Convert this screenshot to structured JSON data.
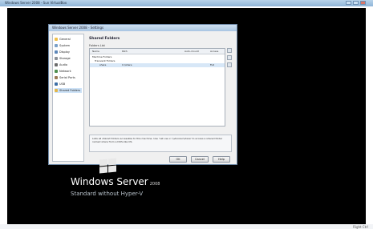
{
  "window": {
    "title": "Windows Server 2008 - Sun VirtualBox"
  },
  "status_bar": {
    "text": "Right Ctrl"
  },
  "background": {
    "product": "Windows Server",
    "version": "2008",
    "subtitle": "Standard without Hyper-V"
  },
  "dialog": {
    "title": "Windows Server 2008 - Settings",
    "nav": [
      "General",
      "System",
      "Display",
      "Storage",
      "Audio",
      "Network",
      "Serial Ports",
      "USB",
      "Shared Folders"
    ],
    "section_title": "Shared Folders",
    "folders_label": "Folders List",
    "columns": [
      "Name",
      "Path",
      "Auto-mount",
      "Access"
    ],
    "rows": [
      {
        "name": "Machine Folders",
        "path": "",
        "access": ""
      },
      {
        "name": "Transient Folders",
        "path": "",
        "access": ""
      },
      {
        "name": "share",
        "path": "C:\\share",
        "access": "Full"
      }
    ],
    "info_text": "Lists all shared folders accessible to this machine. Use 'net use x: \\\\vboxsvr\\share' to access a shared folder named share from a DOS-like OS.",
    "buttons": {
      "ok": "OK",
      "cancel": "Cancel",
      "help": "Help"
    }
  }
}
